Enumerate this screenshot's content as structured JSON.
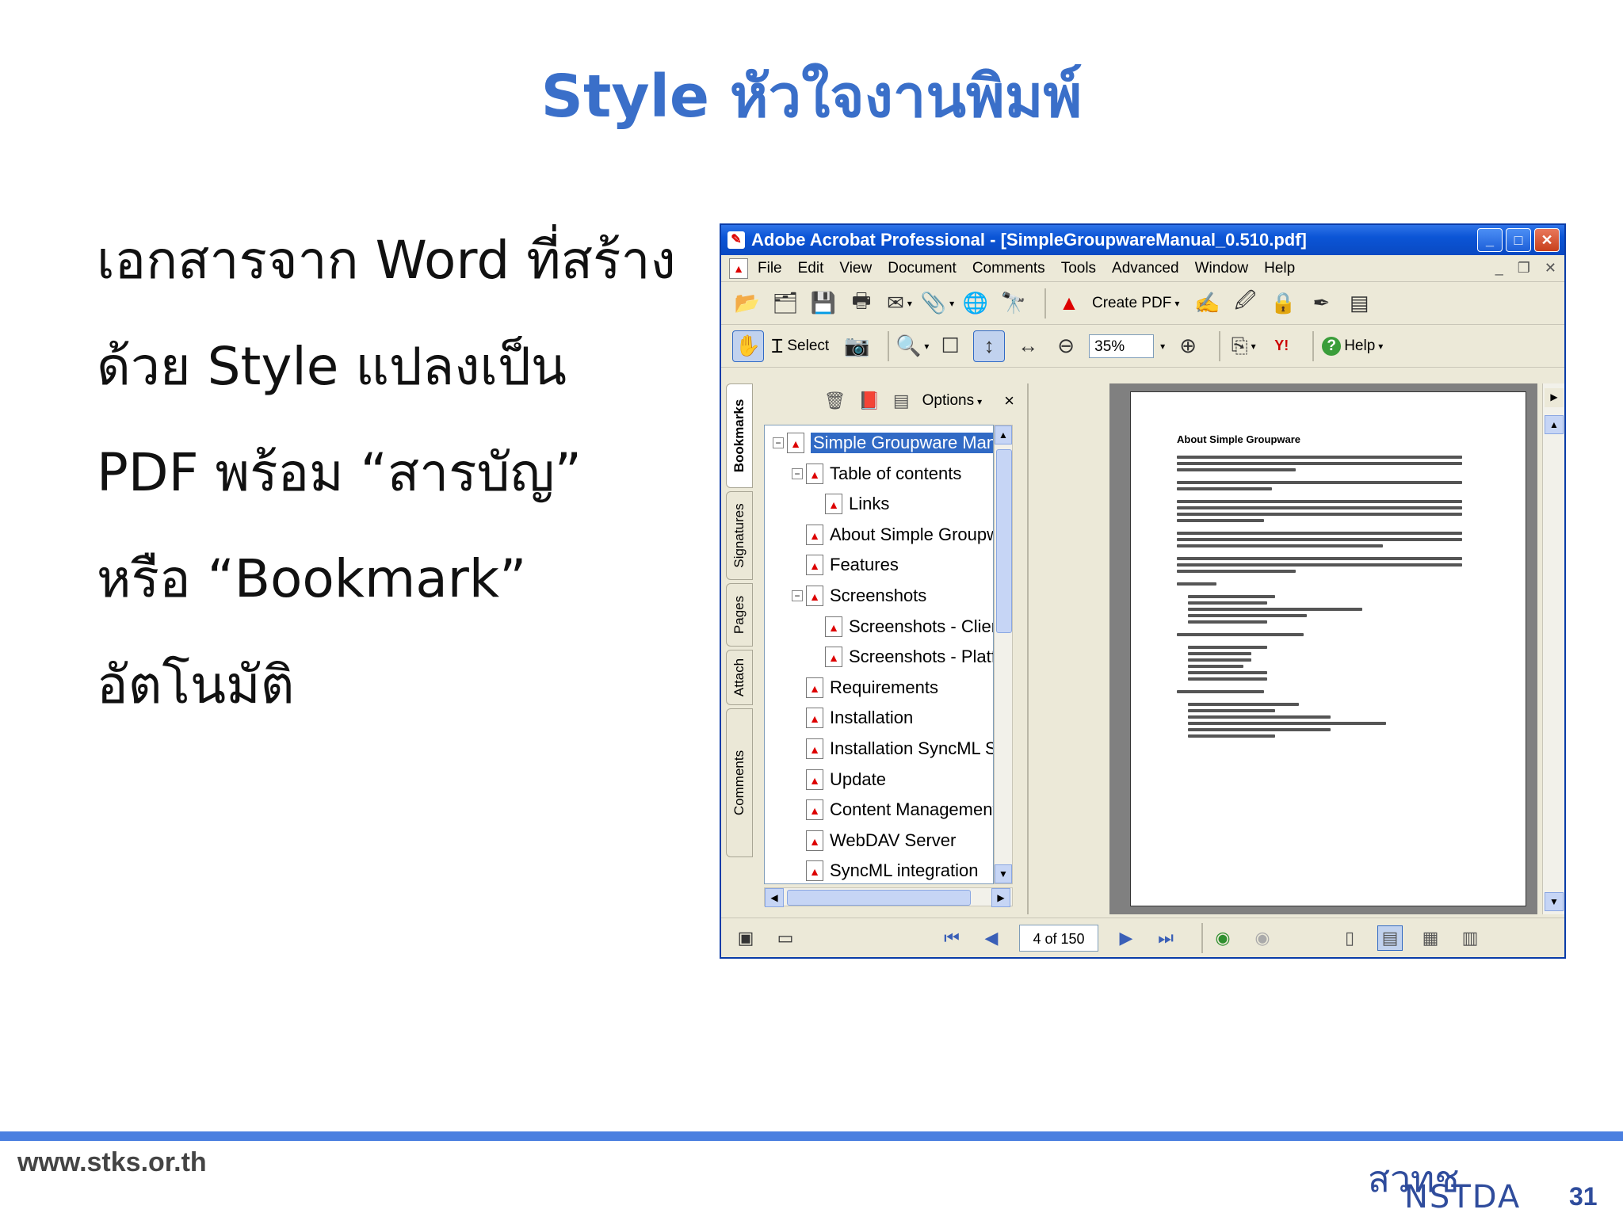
{
  "slide": {
    "title": "Style หัวใจงานพิมพ์",
    "bullets": [
      "เอกสารจาก Word ที่สร้าง",
      "ด้วย Style แปลงเป็น",
      "PDF พร้อม “สารบัญ”",
      "หรือ “Bookmark”",
      "อัตโนมัติ"
    ],
    "footer_url": "www.stks.or.th",
    "logo_thai": "สวทช",
    "logo_en": "NSTDA",
    "page_number": "31"
  },
  "app": {
    "title": "Adobe Acrobat Professional - [SimpleGroupwareManual_0.510.pdf]",
    "menu": [
      "File",
      "Edit",
      "View",
      "Document",
      "Comments",
      "Tools",
      "Advanced",
      "Window",
      "Help"
    ],
    "toolbar": {
      "create_pdf": "Create PDF",
      "select": "Select",
      "zoom": "35%",
      "help": "Help"
    },
    "sidetabs": [
      "Bookmarks",
      "Signatures",
      "Pages",
      "Attach",
      "Comments"
    ],
    "bookmarks_panel": {
      "options_label": "Options",
      "close": "×",
      "items": [
        {
          "label": "Simple Groupware Manual",
          "level": 0,
          "expander": "−",
          "selected": true
        },
        {
          "label": "Table of contents",
          "level": 1,
          "expander": "−"
        },
        {
          "label": "Links",
          "level": 2
        },
        {
          "label": "About Simple Groupware",
          "level": 1
        },
        {
          "label": "Features",
          "level": 1
        },
        {
          "label": "Screenshots",
          "level": 1,
          "expander": "−"
        },
        {
          "label": "Screenshots - Client",
          "level": 2
        },
        {
          "label": "Screenshots - Platforms",
          "level": 2
        },
        {
          "label": "Requirements",
          "level": 1
        },
        {
          "label": "Installation",
          "level": 1
        },
        {
          "label": "Installation SyncML Server",
          "level": 1
        },
        {
          "label": "Update",
          "level": 1
        },
        {
          "label": "Content Management",
          "level": 1
        },
        {
          "label": "WebDAV Server",
          "level": 1
        },
        {
          "label": "SyncML integration",
          "level": 1
        }
      ]
    },
    "document": {
      "heading": "About Simple Groupware"
    },
    "statusbar": {
      "page_indicator": "4 of 150"
    }
  }
}
